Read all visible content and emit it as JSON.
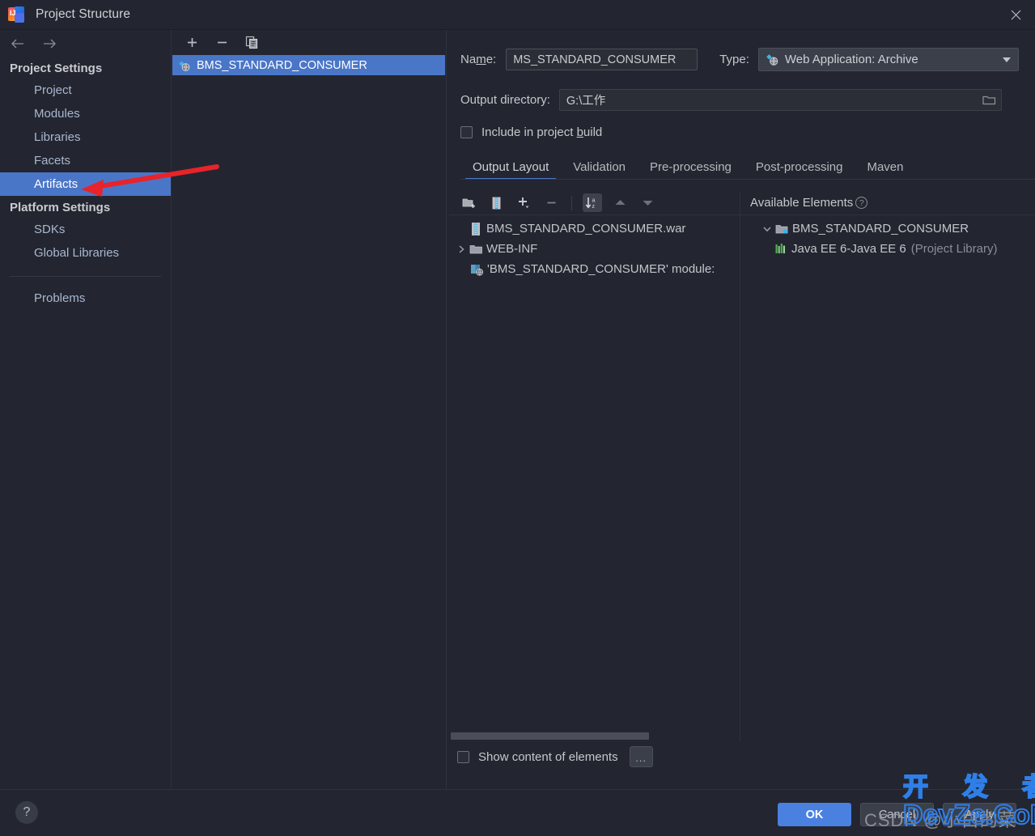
{
  "window": {
    "title": "Project Structure",
    "app_icon": "intellij-idea-icon",
    "close_label": "✕"
  },
  "sidebar": {
    "back_icon": "arrow-left-icon",
    "forward_icon": "arrow-right-icon",
    "groups": [
      {
        "title": "Project Settings",
        "items": [
          {
            "label": "Project",
            "selected": false
          },
          {
            "label": "Modules",
            "selected": false
          },
          {
            "label": "Libraries",
            "selected": false
          },
          {
            "label": "Facets",
            "selected": false
          },
          {
            "label": "Artifacts",
            "selected": true
          }
        ]
      },
      {
        "title": "Platform Settings",
        "items": [
          {
            "label": "SDKs",
            "selected": false
          },
          {
            "label": "Global Libraries",
            "selected": false
          }
        ]
      }
    ],
    "problems": {
      "label": "Problems"
    }
  },
  "artifact_pane": {
    "toolbar": [
      {
        "icon": "plus-icon",
        "title": "Add"
      },
      {
        "icon": "minus-icon",
        "title": "Remove"
      },
      {
        "icon": "copy-icon",
        "title": "Copy"
      }
    ],
    "items": [
      {
        "label": "BMS_STANDARD_CONSUMER",
        "icon": "artifact-war-icon",
        "selected": true
      }
    ]
  },
  "detail": {
    "name_label": "Name:",
    "name_label_pre": "Na",
    "name_label_mnemonic": "m",
    "name_label_post": "e:",
    "name_value": "MS_STANDARD_CONSUMER",
    "type_label": "Type:",
    "type_value": "Web Application: Archive",
    "type_icon": "web-archive-icon",
    "type_caret": "chevron-down-icon",
    "output_label": "Output directory:",
    "output_value": "G:\\工作",
    "browse_icon": "folder-browse-icon",
    "include_label_pre": "Include in project ",
    "include_label_mnemonic": "b",
    "include_label_post": "uild",
    "include_checked": false,
    "tabs": [
      {
        "label": "Output Layout",
        "active": true
      },
      {
        "label": "Validation",
        "active": false
      },
      {
        "label": "Pre-processing",
        "active": false
      },
      {
        "label": "Post-processing",
        "active": false
      },
      {
        "label": "Maven",
        "active": false
      }
    ]
  },
  "output_layout": {
    "toolbar": [
      {
        "icon": "add-directory-icon",
        "pressed": false
      },
      {
        "icon": "add-archive-icon",
        "pressed": false
      },
      {
        "icon": "plus-dropdown-icon",
        "pressed": false
      },
      {
        "icon": "minus-icon",
        "pressed": false
      },
      {
        "icon": "sort-alphabetically-icon",
        "pressed": true
      },
      {
        "icon": "move-up-icon",
        "pressed": false
      },
      {
        "icon": "move-down-icon",
        "pressed": false
      }
    ],
    "tree": [
      {
        "label": "BMS_STANDARD_CONSUMER.war",
        "icon": "archive-icon",
        "twist": "none",
        "indent": 1,
        "dim": ""
      },
      {
        "label": "WEB-INF",
        "icon": "folder-icon",
        "twist": "collapsed",
        "indent": 2,
        "dim": ""
      },
      {
        "label": "'BMS_STANDARD_CONSUMER' module:",
        "icon": "module-output-icon",
        "twist": "none",
        "indent": 2,
        "dim": ""
      }
    ],
    "scrollbar": "horizontal-scrollbar",
    "show_content_label": "Show content of elements",
    "show_content_checked": false,
    "ellipsis_label": "..."
  },
  "available_elements": {
    "title": "Available Elements",
    "help_icon": "question-mark-icon",
    "tree": [
      {
        "label": "BMS_STANDARD_CONSUMER",
        "icon": "module-icon",
        "twist": "expanded",
        "indent": 2,
        "dim": ""
      },
      {
        "label": "Java EE 6-Java EE 6",
        "icon": "library-icon",
        "twist": "none",
        "indent": 3,
        "dim": "(Project Library)"
      }
    ]
  },
  "footer": {
    "help_label": "?",
    "ok_label": "OK",
    "cancel_label": "Cancel",
    "apply_label": "Apply"
  },
  "annotation": {
    "arrow_color": "#e8232a",
    "target": "Artifacts"
  },
  "watermark": {
    "csdn": "CSDN @小白的菜",
    "cn": "开 发 者",
    "en": "DevZe.CoM"
  },
  "colors": {
    "background": "#232630",
    "selection_blue": "#4a76c8",
    "ok_button": "#4a80e0",
    "text": "#c3c5ca",
    "dim_text": "#8b8e96"
  }
}
